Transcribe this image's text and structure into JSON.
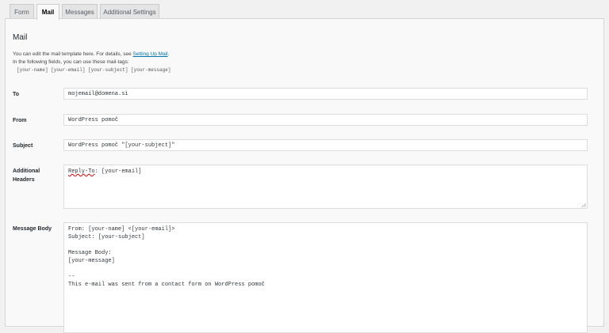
{
  "tabs": [
    {
      "label": "Form"
    },
    {
      "label": "Mail"
    },
    {
      "label": "Messages"
    },
    {
      "label": "Additional Settings"
    }
  ],
  "mail": {
    "title": "Mail",
    "description_prefix": "You can edit the mail template here. For details, see ",
    "description_link": "Setting Up Mail",
    "description_suffix": ".",
    "tags_intro": "In the following fields, you can use these mail-tags:",
    "tags": "[your-name] [your-email] [your-subject] [your-message]"
  },
  "fields": {
    "to": {
      "label": "To",
      "value": "mojemail@domena.si"
    },
    "from": {
      "label": "From",
      "value": "WordPress pomoč"
    },
    "subject": {
      "label": "Subject",
      "value": "WordPress pomoč \"[your-subject]\""
    },
    "headers": {
      "label_line1": "Additional",
      "label_line2": "Headers",
      "value_key": "Reply-To",
      "value_rest": ": [your-email]"
    },
    "body": {
      "label": "Message Body",
      "value": "From: [your-name] <[your-email]>\nSubject: [your-subject]\n\nMessage Body:\n[your-message]\n\n--\nThis e-mail was sent from a contact form on WordPress pomoč"
    }
  }
}
